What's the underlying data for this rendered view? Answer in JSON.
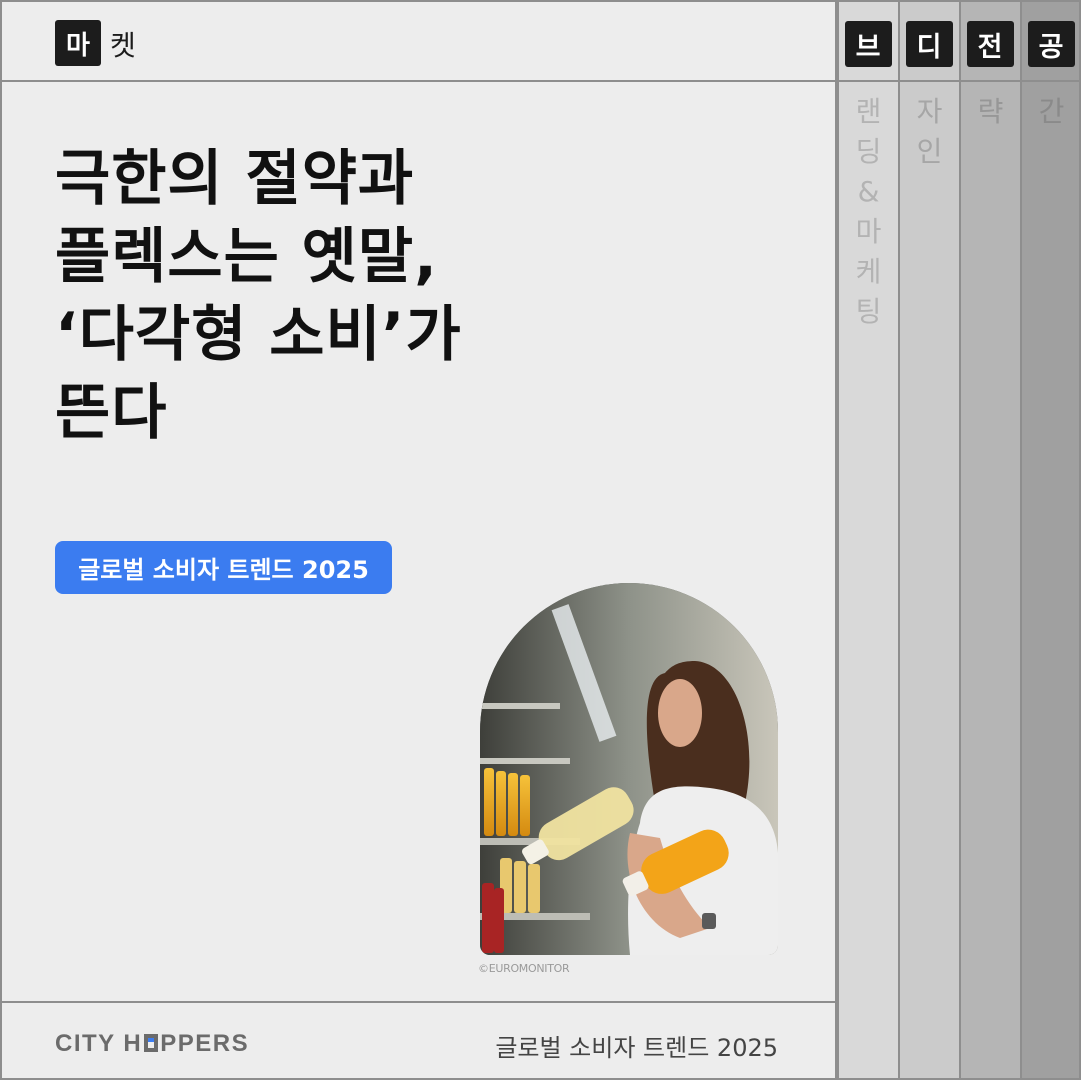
{
  "header": {
    "category_key": "마",
    "category_rest": "켓"
  },
  "columns": [
    {
      "key": "브",
      "text": [
        "랜",
        "딩",
        "&",
        "마",
        "케",
        "팅"
      ]
    },
    {
      "key": "디",
      "text": [
        "자",
        "인"
      ]
    },
    {
      "key": "전",
      "text": [
        "략"
      ]
    },
    {
      "key": "공",
      "text": [
        "간"
      ]
    }
  ],
  "headline": {
    "lines": [
      "극한의 절약과",
      "플렉스는 옛말,",
      "‘다각형 소비’가",
      "뜬다"
    ]
  },
  "tag": "글로벌 소비자 트렌드 2025",
  "photo": {
    "credit": "©EUROMONITOR"
  },
  "footer": {
    "brand_left": "CITY H",
    "brand_right": "PPERS",
    "text": "글로벌 소비자 트렌드 2025"
  },
  "colors": {
    "accent": "#3b7cf0",
    "dark": "#1c1c1c",
    "background": "#ededed",
    "border": "#8e8e8e"
  }
}
